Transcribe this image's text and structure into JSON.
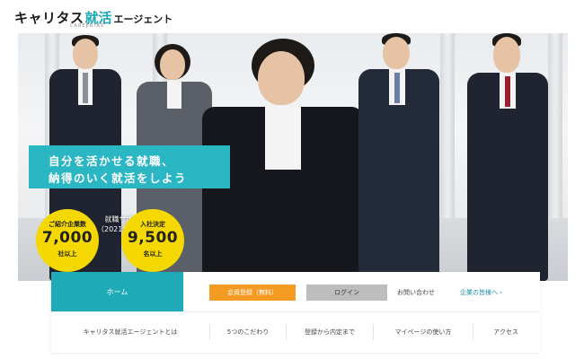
{
  "header": {
    "brand_katakana": "キャリタス",
    "brand_kanji": "就活",
    "brand_suffix": "エージェント",
    "brand_sub": "CAREERTAS"
  },
  "hero": {
    "headline_line1": "自分を活かせる就職、",
    "headline_line2": "納得のいく就活をしよう",
    "support_label": "就職サポート実績",
    "support_date": "（2021年 10月現在）",
    "stats": [
      {
        "label": "ご紹介企業数",
        "value": "7,000",
        "unit": "社以上"
      },
      {
        "label": "入社決定",
        "value": "9,500",
        "unit": "名以上"
      }
    ],
    "accent_color": "#2bb6c3",
    "stat_color": "#f4d800"
  },
  "nav": {
    "home": "ホーム",
    "member_register": "会員登録（無料）",
    "login": "ログイン",
    "contact": "お問い合わせ",
    "company_link": "企業の皆様へ ›",
    "menu": [
      "キャリタス就活エージェントとは",
      "5つのこだわり",
      "登録から内定まで",
      "マイページの使い方",
      "アクセス"
    ]
  }
}
